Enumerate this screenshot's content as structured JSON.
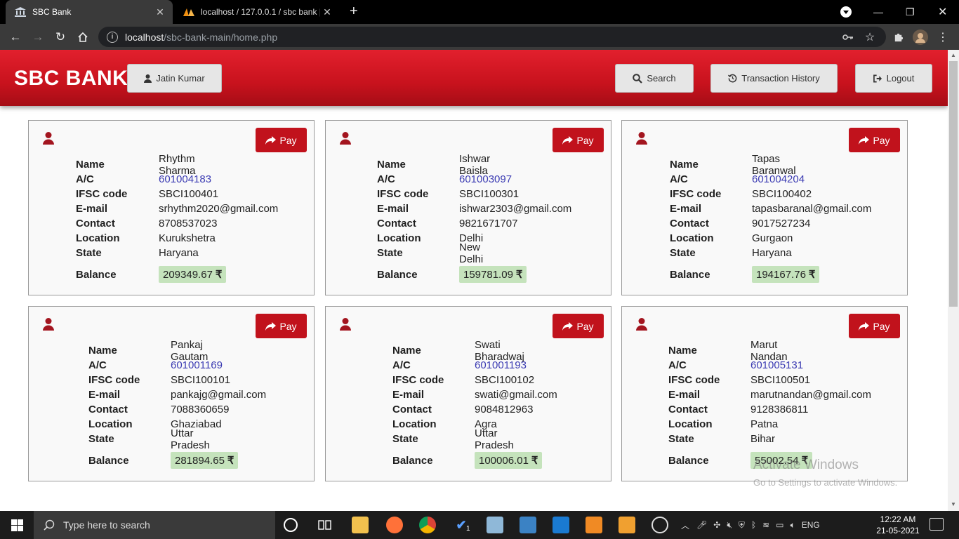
{
  "browser": {
    "tabs": [
      {
        "title": "SBC Bank",
        "active": true
      },
      {
        "title": "localhost / 127.0.0.1 / sbc bank | ",
        "active": false
      }
    ],
    "url_host": "localhost",
    "url_path": "/sbc-bank-main/home.php"
  },
  "header": {
    "brand": "SBC BANK",
    "user_label": "Jatin Kumar",
    "search_label": "Search",
    "history_label": "Transaction History",
    "logout_label": "Logout"
  },
  "labels": {
    "name": "Name",
    "ac": "A/C",
    "ifsc": "IFSC code",
    "email": "E-mail",
    "contact": "Contact",
    "location": "Location",
    "state": "State",
    "balance": "Balance",
    "pay": "Pay",
    "currency": "₹"
  },
  "customers": [
    {
      "name": "Rhythm Sharma",
      "ac": "601004183",
      "ifsc": "SBCI100401",
      "email": "srhythm2020@gmail.com",
      "contact": "8708537023",
      "location": "Kurukshetra",
      "state": "Haryana",
      "balance": "209349.67"
    },
    {
      "name": "Ishwar Baisla",
      "ac": "601003097",
      "ifsc": "SBCI100301",
      "email": "ishwar2303@gmail.com",
      "contact": "9821671707",
      "location": "Delhi",
      "state": "New Delhi",
      "balance": "159781.09"
    },
    {
      "name": "Tapas Baranwal",
      "ac": "601004204",
      "ifsc": "SBCI100402",
      "email": "tapasbaranal@gmail.com",
      "contact": "9017527234",
      "location": "Gurgaon",
      "state": "Haryana",
      "balance": "194167.76"
    },
    {
      "name": "Pankaj Gautam",
      "ac": "601001169",
      "ifsc": "SBCI100101",
      "email": "pankajg@gmail.com",
      "contact": "7088360659",
      "location": "Ghaziabad",
      "state": "Uttar Pradesh",
      "balance": "281894.65"
    },
    {
      "name": "Swati Bharadwaj",
      "ac": "601001193",
      "ifsc": "SBCI100102",
      "email": "swati@gmail.com",
      "contact": "9084812963",
      "location": "Agra",
      "state": "Uttar Pradesh",
      "balance": "100006.01"
    },
    {
      "name": "Marut Nandan",
      "ac": "601005131",
      "ifsc": "SBCI100501",
      "email": "marutnandan@gmail.com",
      "contact": "9128386811",
      "location": "Patna",
      "state": "Bihar",
      "balance": "55002.54"
    }
  ],
  "watermark": {
    "line1": "Activate Windows",
    "line2": "Go to Settings to activate Windows."
  },
  "taskbar": {
    "search_placeholder": "Type here to search",
    "lang": "ENG",
    "time": "12:22 AM",
    "date": "21-05-2021",
    "badge": "1"
  }
}
